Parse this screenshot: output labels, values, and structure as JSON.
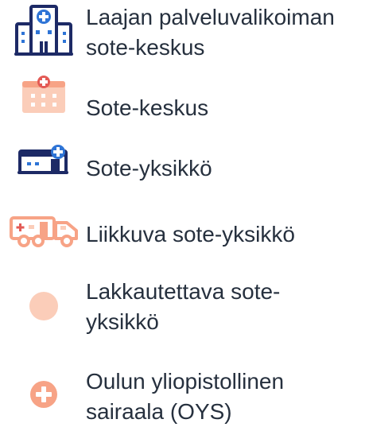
{
  "colors": {
    "navy": "#1d2a66",
    "blue": "#2e74d6",
    "salmon": "#f7a386",
    "salmon_light": "#fbcdb9",
    "red_cross": "#e35a55",
    "text": "#26303e"
  },
  "legend": {
    "items": [
      {
        "icon": "large-hospital-building-icon",
        "label_lines": [
          "Laajan palveluvalikoiman",
          "sote-keskus"
        ]
      },
      {
        "icon": "health-center-building-icon",
        "label_lines": [
          "Sote-keskus"
        ]
      },
      {
        "icon": "health-unit-building-icon",
        "label_lines": [
          "Sote-yksikkö"
        ]
      },
      {
        "icon": "mobile-unit-truck-icon",
        "label_lines": [
          "Liikkuva sote-yksikkö"
        ]
      },
      {
        "icon": "closing-unit-circle-icon",
        "label_lines": [
          "Lakkautettava sote-",
          "yksikkö"
        ]
      },
      {
        "icon": "university-hospital-cross-icon",
        "label_lines": [
          "Oulun yliopistollinen",
          "sairaala (OYS)"
        ]
      }
    ]
  }
}
